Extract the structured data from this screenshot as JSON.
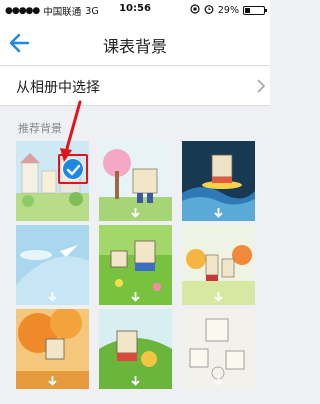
{
  "status": {
    "carrier": "中国联通",
    "network": "3G",
    "time": "10:56",
    "battery": "29%",
    "battery_level": 0.29
  },
  "nav": {
    "title": "课表背景",
    "back_icon": "back-arrow-icon"
  },
  "album_option": {
    "label": "从相册中选择",
    "chevron_icon": "chevron-right-icon"
  },
  "section": {
    "label": "推荐背景"
  },
  "backgrounds": [
    {
      "theme": "town scene",
      "selected": true
    },
    {
      "theme": "pink tree",
      "selected": false
    },
    {
      "theme": "surfing",
      "selected": false
    },
    {
      "theme": "blue sky paper plane",
      "selected": false
    },
    {
      "theme": "green grass",
      "selected": false
    },
    {
      "theme": "colorful trees",
      "selected": false
    },
    {
      "theme": "autumn tree",
      "selected": false
    },
    {
      "theme": "green hill",
      "selected": false
    },
    {
      "theme": "sketch",
      "selected": false
    }
  ],
  "colors": {
    "accent": "#1e88e5",
    "annotation": "#e0141c",
    "background": "#eef0f3"
  }
}
